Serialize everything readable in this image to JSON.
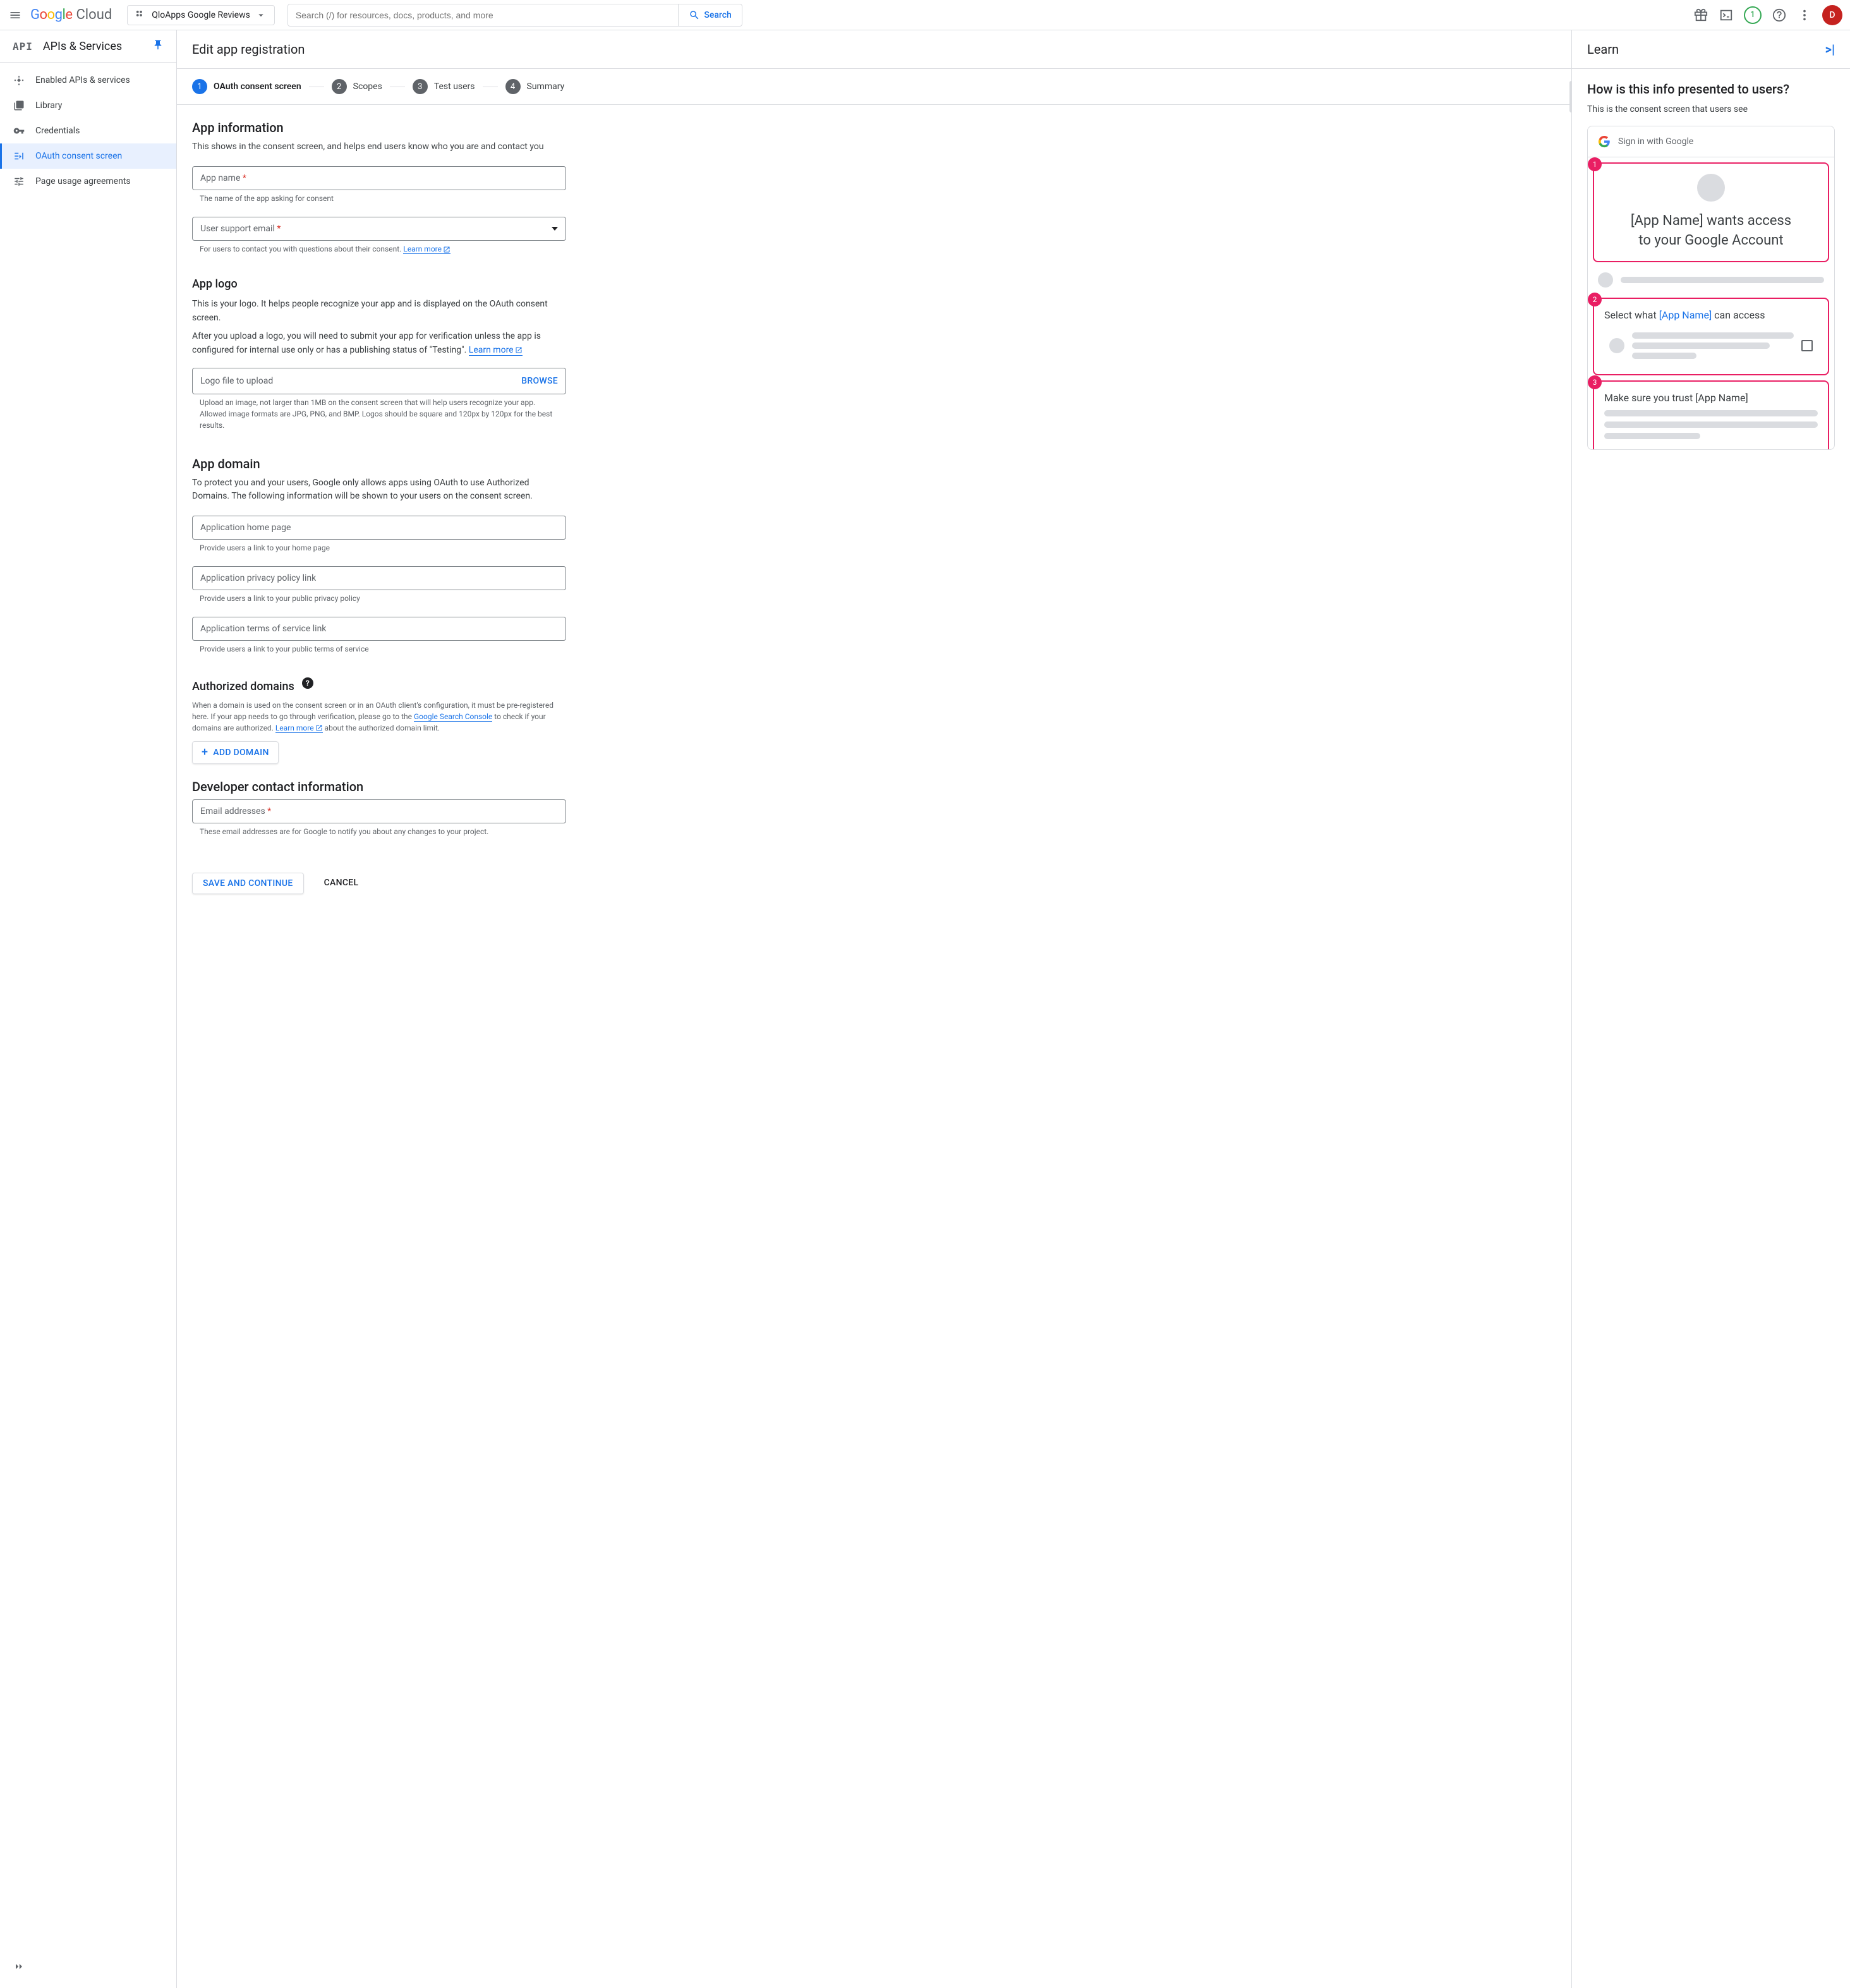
{
  "header": {
    "project": "QloApps Google Reviews",
    "search_placeholder": "Search (/) for resources, docs, products, and more",
    "search_btn": "Search",
    "badge": "1",
    "avatar": "D"
  },
  "sidebar": {
    "api_label": "API",
    "title": "APIs & Services",
    "items": [
      {
        "label": "Enabled APIs & services"
      },
      {
        "label": "Library"
      },
      {
        "label": "Credentials"
      },
      {
        "label": "OAuth consent screen"
      },
      {
        "label": "Page usage agreements"
      }
    ]
  },
  "page": {
    "title": "Edit app registration",
    "steps": [
      {
        "num": "1",
        "label": "OAuth consent screen"
      },
      {
        "num": "2",
        "label": "Scopes"
      },
      {
        "num": "3",
        "label": "Test users"
      },
      {
        "num": "4",
        "label": "Summary"
      }
    ],
    "app_info": {
      "title": "App information",
      "desc": "This shows in the consent screen, and helps end users know who you are and contact you",
      "app_name_label": "App name",
      "app_name_help": "The name of the app asking for consent",
      "email_label": "User support email",
      "email_help": "For users to contact you with questions about their consent. ",
      "learn_more": "Learn more"
    },
    "app_logo": {
      "title": "App logo",
      "p1": "This is your logo. It helps people recognize your app and is displayed on the OAuth consent screen.",
      "p2a": "After you upload a logo, you will need to submit your app for verification unless the app is configured for internal use only or has a publishing status of \"Testing\". ",
      "learn_more": "Learn more",
      "upload_label": "Logo file to upload",
      "browse": "BROWSE",
      "upload_help": "Upload an image, not larger than 1MB on the consent screen that will help users recognize your app. Allowed image formats are JPG, PNG, and BMP. Logos should be square and 120px by 120px for the best results."
    },
    "app_domain": {
      "title": "App domain",
      "desc": "To protect you and your users, Google only allows apps using OAuth to use Authorized Domains. The following information will be shown to your users on the consent screen.",
      "home_label": "Application home page",
      "home_help": "Provide users a link to your home page",
      "privacy_label": "Application privacy policy link",
      "privacy_help": "Provide users a link to your public privacy policy",
      "tos_label": "Application terms of service link",
      "tos_help": "Provide users a link to your public terms of service"
    },
    "auth_domains": {
      "title": "Authorized domains",
      "desc1": "When a domain is used on the consent screen or in an OAuth client's configuration, it must be pre-registered here. If your app needs to go through verification, please go to the ",
      "link1": "Google Search Console",
      "desc2": " to check if your domains are authorized. ",
      "link2": "Learn more",
      "desc3": " about the authorized domain limit.",
      "add_btn": "ADD DOMAIN"
    },
    "dev_contact": {
      "title": "Developer contact information",
      "email_label": "Email addresses",
      "email_help": "These email addresses are for Google to notify you about any changes to your project."
    },
    "actions": {
      "save": "SAVE AND CONTINUE",
      "cancel": "CANCEL"
    }
  },
  "learn": {
    "header": "Learn",
    "title": "How is this info presented to users?",
    "desc": "This is the consent screen that users see",
    "signin": "Sign in with Google",
    "box1a": "[App Name] wants access",
    "box1b": "to your Google Account",
    "box2a": "Select what ",
    "box2b": "[App Name]",
    "box2c": " can access",
    "box3": "Make sure you trust [App Name]"
  }
}
